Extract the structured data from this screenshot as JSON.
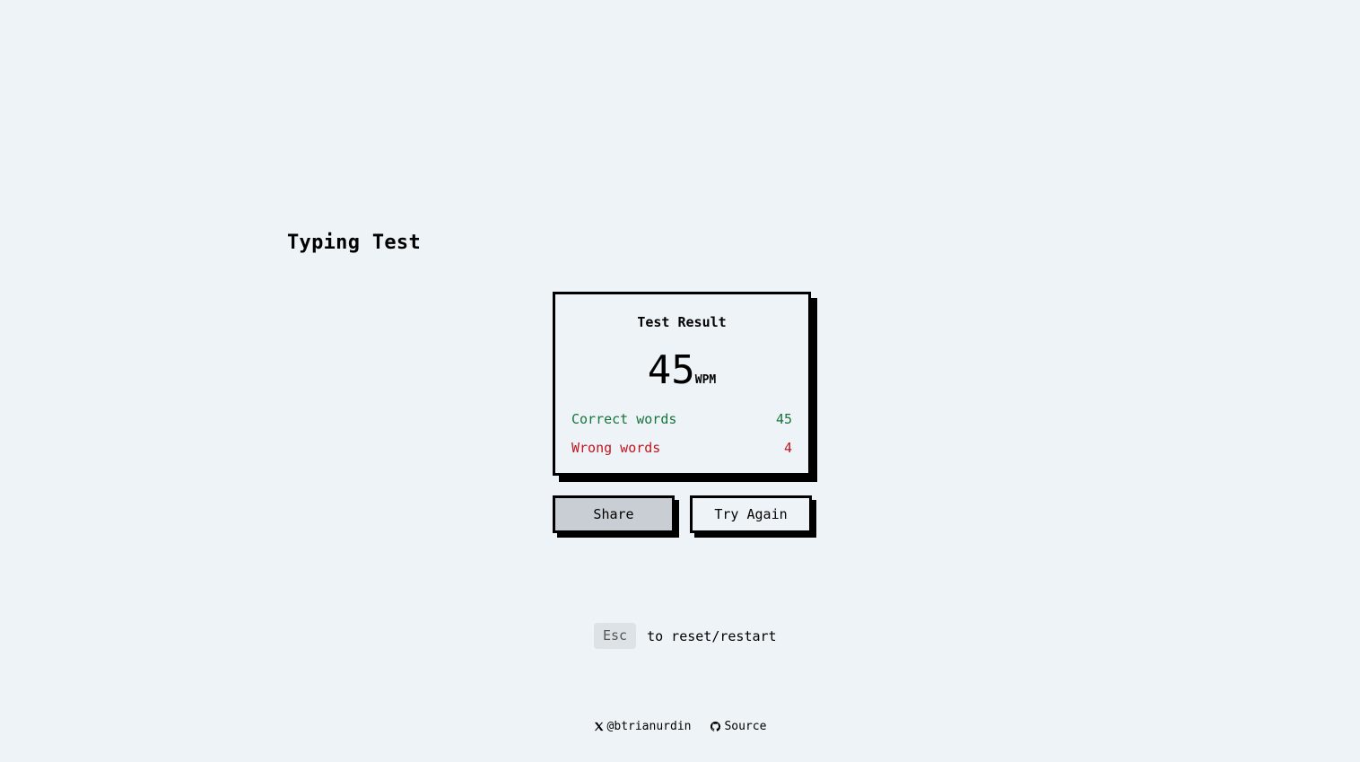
{
  "app": {
    "title": "Typing Test"
  },
  "result": {
    "title": "Test Result",
    "wpm": "45",
    "wpm_unit": "WPM",
    "correct_label": "Correct words",
    "correct_value": "45",
    "wrong_label": "Wrong words",
    "wrong_value": "4"
  },
  "actions": {
    "share_label": "Share",
    "try_again_label": "Try Again"
  },
  "hint": {
    "key": "Esc",
    "text": "to reset/restart"
  },
  "footer": {
    "twitter_label": "@btrianurdin",
    "twitter_icon": "x-logo-icon",
    "source_label": "Source",
    "source_icon": "github-icon"
  },
  "colors": {
    "background": "#eef3f7",
    "correct": "#16753a",
    "wrong": "#c0161e",
    "share_button": "#c9ced5"
  }
}
